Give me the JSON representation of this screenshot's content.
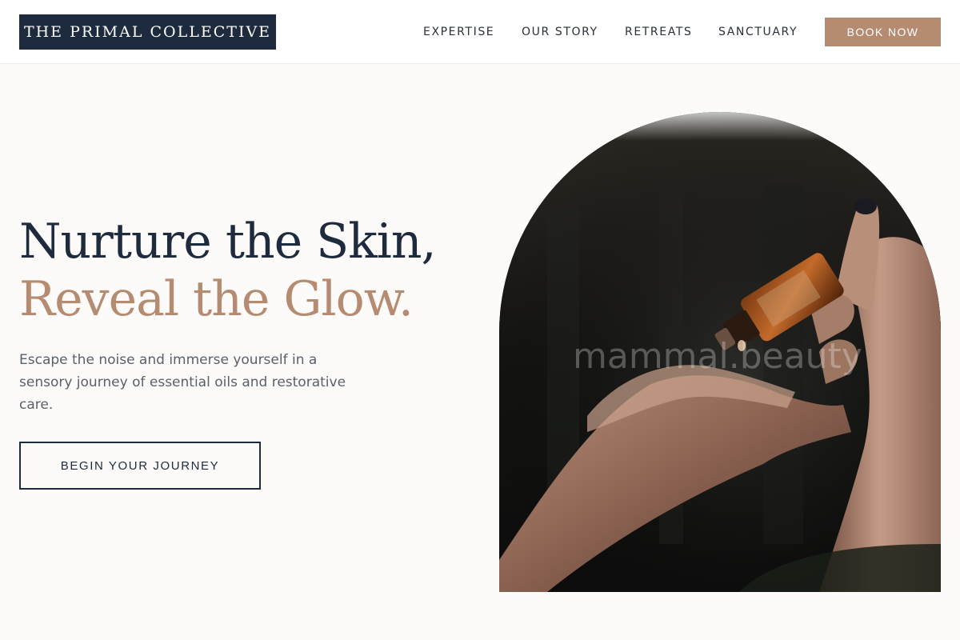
{
  "brand": {
    "name": "THE PRIMAL COLLECTIVE"
  },
  "nav": {
    "items": [
      {
        "label": "EXPERTISE"
      },
      {
        "label": "OUR STORY"
      },
      {
        "label": "RETREATS"
      },
      {
        "label": "SANCTUARY"
      }
    ],
    "cta": "BOOK NOW"
  },
  "hero": {
    "headline_line1": "Nurture the Skin,",
    "headline_line2": "Reveal the Glow.",
    "intro": "Escape the noise and immerse yourself in a sensory journey of essential oils and restorative care.",
    "cta": "BEGIN YOUR JOURNEY",
    "image": {
      "subject": "hand-dropping-essential-oil-photo",
      "watermark": "mammal.beauty"
    }
  },
  "colors": {
    "navy": "#1e2a3d",
    "accent": "#b58c72",
    "background": "#fdfbf9",
    "body_text": "#5a606a"
  }
}
